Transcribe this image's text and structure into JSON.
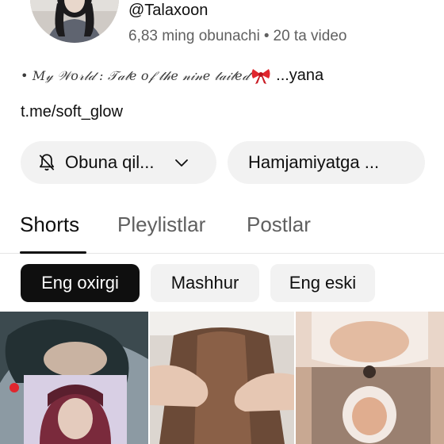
{
  "channel": {
    "handle": "@Talaxoon",
    "subscribers": "6,83 ming obunachi",
    "separator": "•",
    "video_count": "20 ta video",
    "description_fancy": "• 𝑀𝓎 𝒲𝑜𝓇𝓁𝒹 : 𝒯𝒶𝓁𝑒 𝑜𝒻 𝓉𝒽𝑒 𝓃𝒾𝓃𝑒 𝓉𝒶𝒾𝓁𝑒𝒹",
    "description_more": "...yana",
    "link": "t.me/soft_glow"
  },
  "actions": {
    "subscribe_label": "Obuna qil...",
    "community_label": "Hamjamiyatga ..."
  },
  "tabs": [
    {
      "label": "Shorts",
      "active": true
    },
    {
      "label": "Pleylistlar",
      "active": false
    },
    {
      "label": "Postlar",
      "active": false
    }
  ],
  "filters": [
    {
      "label": "Eng oxirgi",
      "active": true
    },
    {
      "label": "Mashhur",
      "active": false
    },
    {
      "label": "Eng eski",
      "active": false
    }
  ],
  "shorts": [
    {
      "menu_icon": "more-vert-icon"
    },
    {
      "menu_icon": "more-vert-icon"
    },
    {
      "menu_icon": "more-vert-icon"
    }
  ],
  "icons": {
    "subscribe_icon": "bell-off-icon",
    "dropdown_icon": "chevron-down-icon",
    "bow_icon": "red-bow-icon"
  },
  "colors": {
    "text_primary": "#0f0f0f",
    "text_secondary": "#606060",
    "chip_bg": "#f2f2f2",
    "active_chip_bg": "#0f0f0f"
  }
}
